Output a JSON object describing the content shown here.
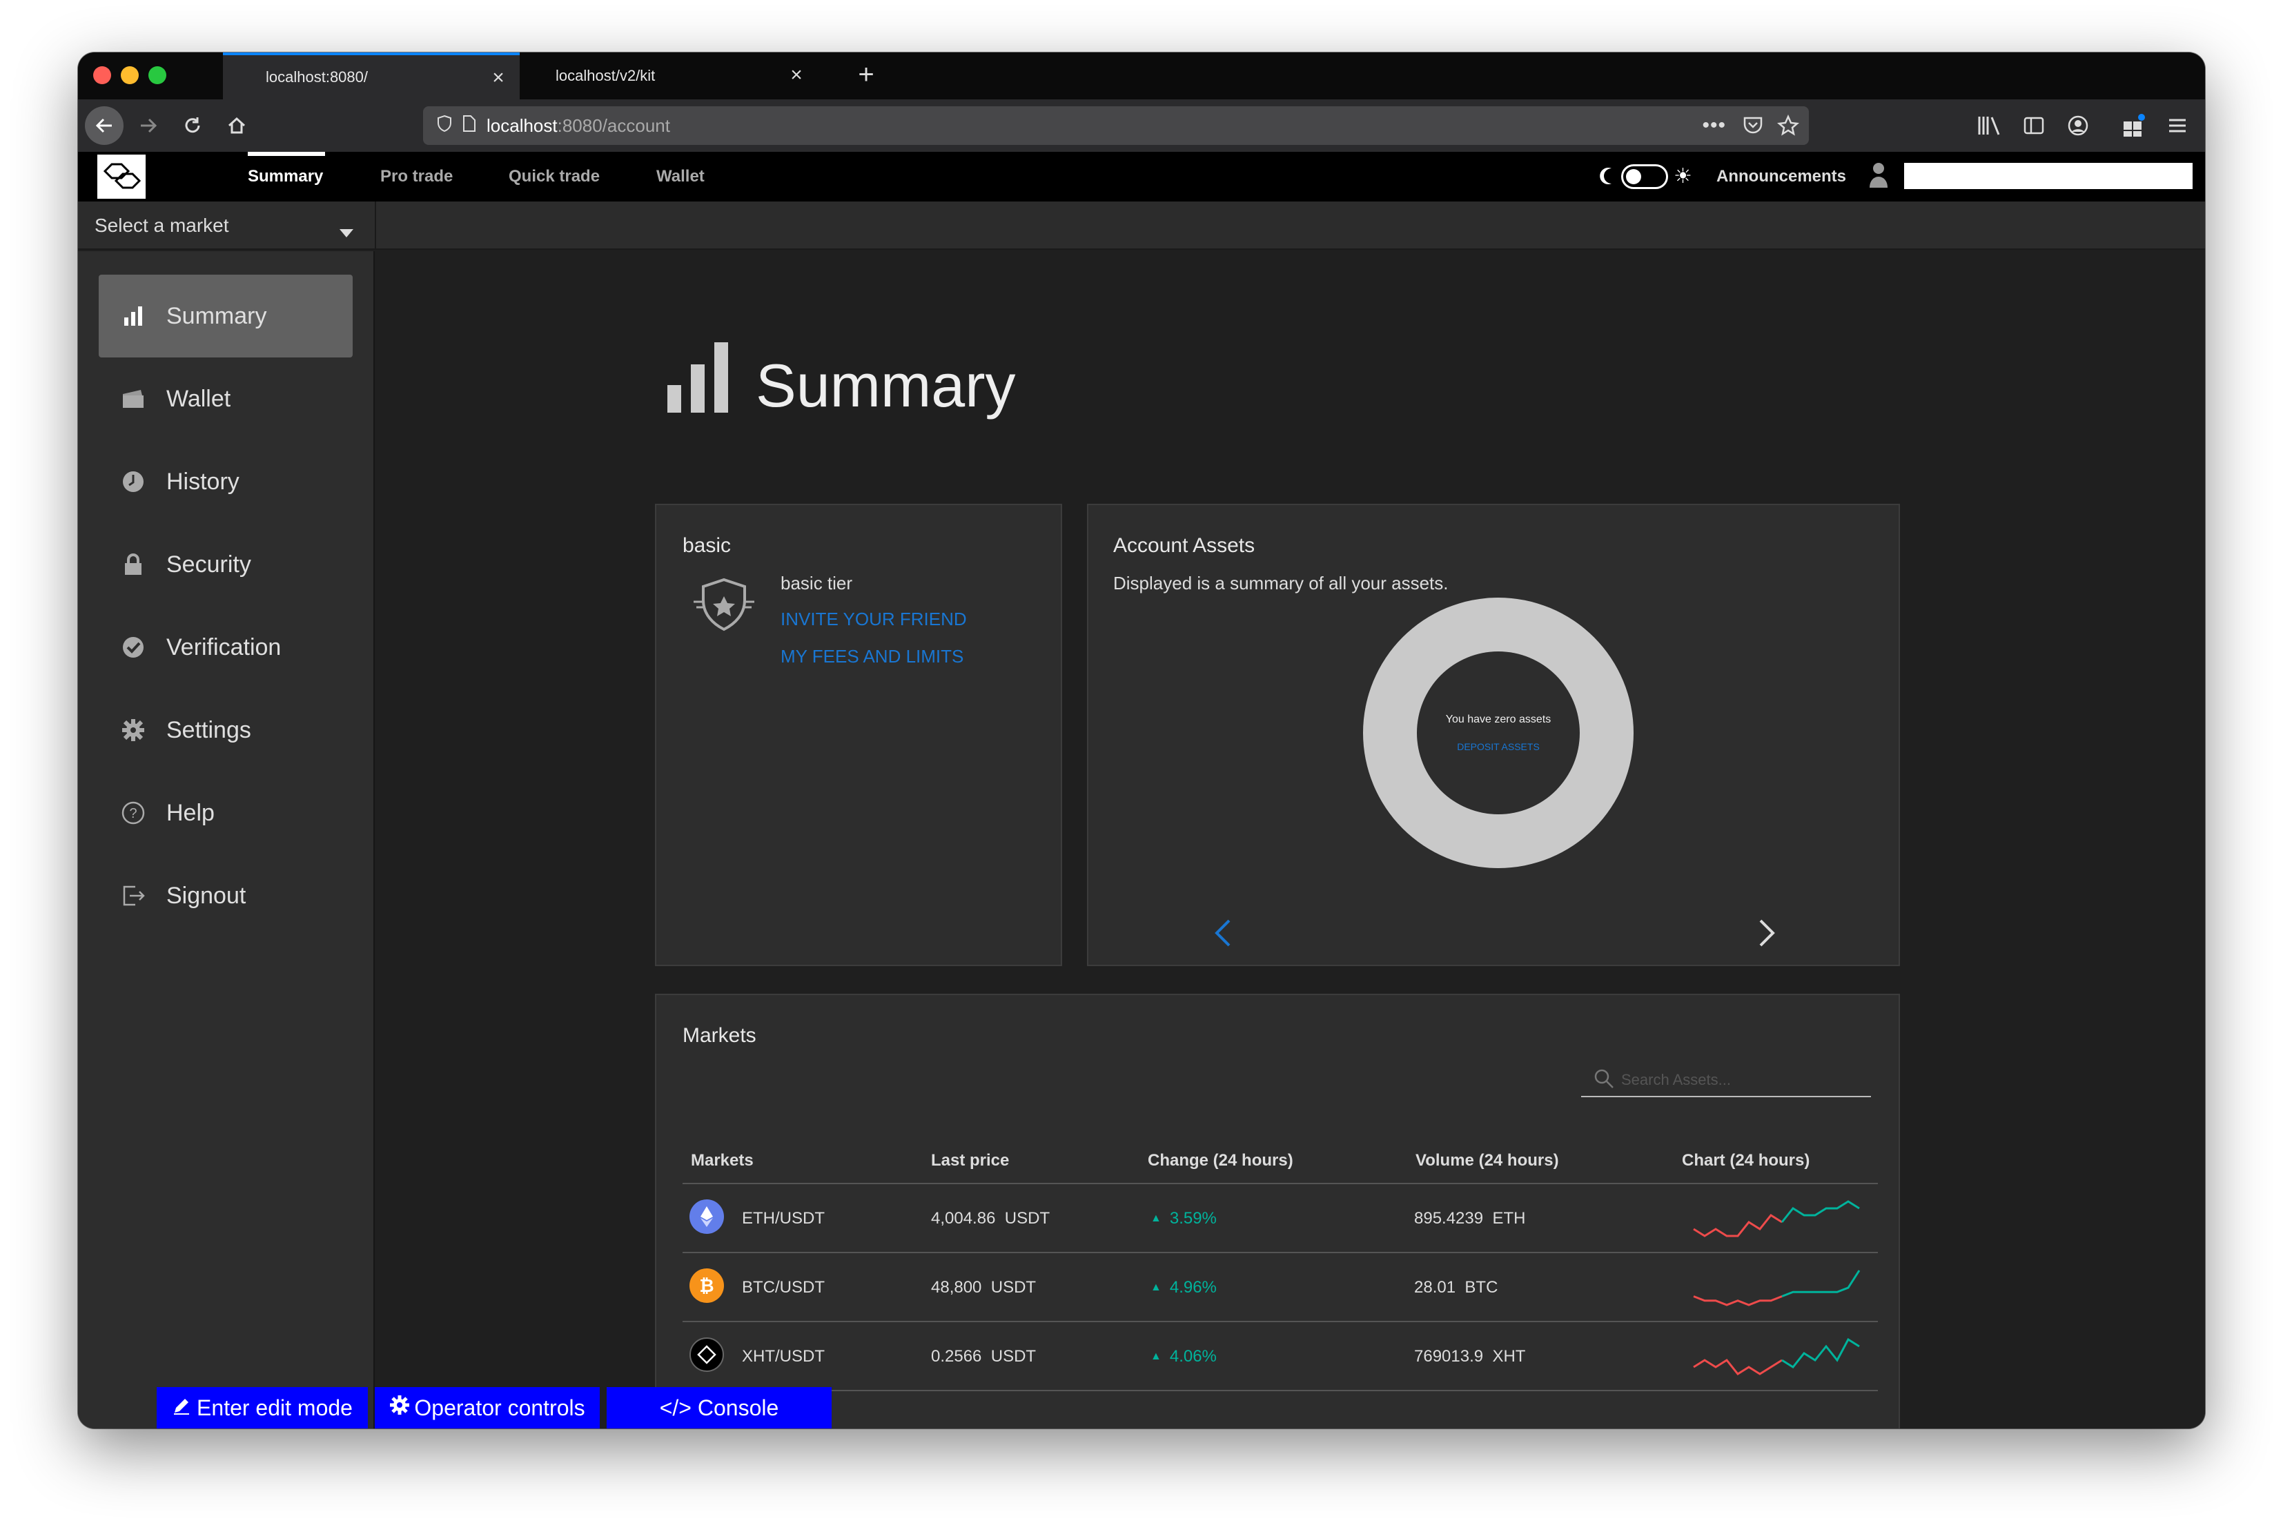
{
  "browser": {
    "tabs": [
      {
        "title": "localhost:8080/",
        "active": true
      },
      {
        "title": "localhost/v2/kit",
        "active": false
      }
    ],
    "url_host": "localhost",
    "url_rest": ":8080/account"
  },
  "app": {
    "nav": {
      "summary": "Summary",
      "pro_trade": "Pro trade",
      "quick_trade": "Quick trade",
      "wallet": "Wallet",
      "announcements": "Announcements",
      "theme_mode": "dark"
    },
    "market_select": {
      "placeholder": "Select a market"
    },
    "sidebar": {
      "items": [
        {
          "label": "Summary",
          "icon": "bar-chart-icon",
          "active": true
        },
        {
          "label": "Wallet",
          "icon": "wallet-icon"
        },
        {
          "label": "History",
          "icon": "clock-icon"
        },
        {
          "label": "Security",
          "icon": "lock-icon"
        },
        {
          "label": "Verification",
          "icon": "check-circle-icon"
        },
        {
          "label": "Settings",
          "icon": "gear-icon"
        },
        {
          "label": "Help",
          "icon": "help-circle-icon"
        },
        {
          "label": "Signout",
          "icon": "signout-icon"
        }
      ]
    },
    "page_title": "Summary",
    "tier_card": {
      "title": "basic",
      "tier_label": "basic tier",
      "invite_link": "INVITE YOUR FRIEND",
      "fees_link": "MY FEES AND LIMITS"
    },
    "assets_card": {
      "title": "Account Assets",
      "description": "Displayed is a summary of all your assets.",
      "donut_text": "You have zero assets",
      "deposit_link": "DEPOSIT ASSETS"
    },
    "markets_card": {
      "title": "Markets",
      "search_placeholder": "Search Assets...",
      "columns": [
        "Markets",
        "Last price",
        "Change (24 hours)",
        "Volume (24 hours)",
        "Chart (24 hours)"
      ],
      "rows": [
        {
          "pair": "ETH/USDT",
          "price": "4,004.86",
          "price_unit": "USDT",
          "change": "3.59%",
          "volume": "895.4239",
          "volume_unit": "ETH",
          "coin": "eth",
          "coin_color": "#627eea",
          "spark": [
            3,
            2,
            3,
            2,
            2,
            4,
            3,
            5,
            4,
            6,
            5,
            5,
            6,
            6,
            7,
            6
          ]
        },
        {
          "pair": "BTC/USDT",
          "price": "48,800",
          "price_unit": "USDT",
          "change": "4.96%",
          "volume": "28.01",
          "volume_unit": "BTC",
          "coin": "btc",
          "coin_color": "#f7931a",
          "spark": [
            4,
            3,
            3,
            2,
            3,
            2,
            3,
            3,
            4,
            5,
            5,
            5,
            5,
            5,
            6,
            10
          ]
        },
        {
          "pair": "XHT/USDT",
          "price": "0.2566",
          "price_unit": "USDT",
          "change": "4.06%",
          "volume": "769013.9",
          "volume_unit": "XHT",
          "coin": "xht",
          "coin_color": "#000000",
          "spark": [
            4,
            5,
            4,
            5,
            3,
            4,
            3,
            4,
            5,
            4,
            6,
            5,
            7,
            5,
            8,
            7
          ]
        }
      ]
    },
    "toolbar": {
      "edit_mode": "Enter edit mode",
      "operator_controls": "Operator controls",
      "console": "</> Console"
    },
    "colors": {
      "accent": "#1976d2",
      "positive": "#00b39c",
      "negative": "#ee4b4b",
      "operator_bar": "#0000ff"
    }
  }
}
